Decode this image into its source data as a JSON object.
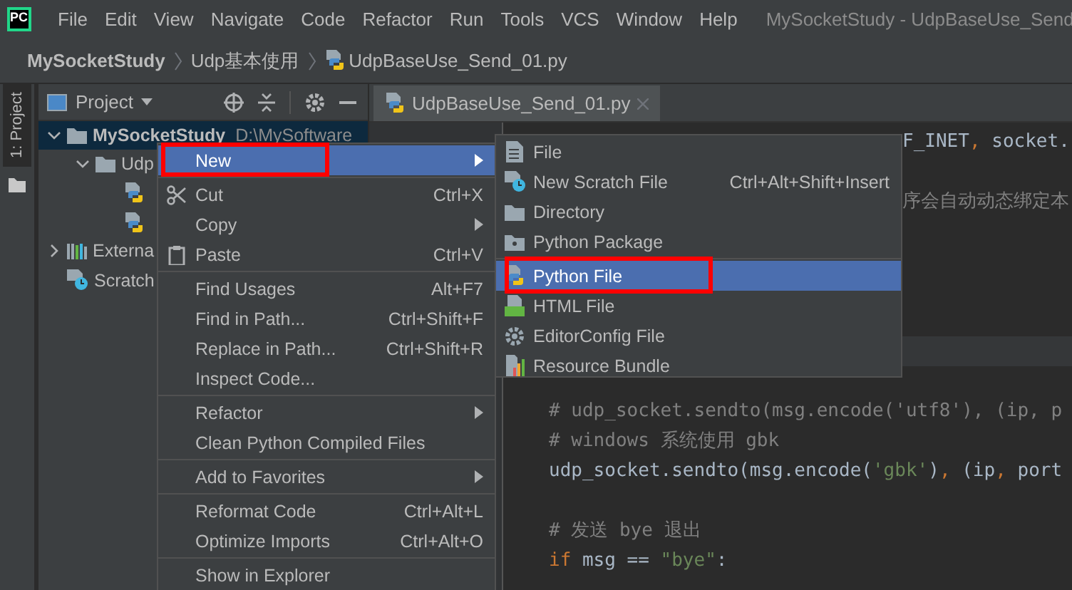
{
  "window": {
    "title": "MySocketStudy - UdpBaseUse_Send",
    "logo": "PC"
  },
  "menu_bar": [
    "File",
    "Edit",
    "View",
    "Navigate",
    "Code",
    "Refactor",
    "Run",
    "Tools",
    "VCS",
    "Window",
    "Help"
  ],
  "breadcrumbs": [
    {
      "label": "MySocketStudy",
      "kind": "project"
    },
    {
      "label": "Udp基本使用",
      "kind": "folder"
    },
    {
      "label": "UdpBaseUse_Send_01.py",
      "kind": "python"
    }
  ],
  "tool_strip": {
    "label": "1: Project"
  },
  "project_panel": {
    "title": "Project",
    "tree": [
      {
        "label": "MySocketStudy",
        "detail": "D:\\MySoftware",
        "kind": "folder",
        "expanded": true,
        "selected": true,
        "children": [
          {
            "label": "Udp",
            "kind": "folder",
            "expanded": true,
            "selected": false,
            "children": [
              {
                "kind": "python",
                "selected": false
              },
              {
                "kind": "python",
                "selected": false
              }
            ]
          }
        ]
      },
      {
        "label": "Externa",
        "kind": "library",
        "expanded": false,
        "selected": false
      },
      {
        "label": "Scratch",
        "kind": "scratch",
        "selected": false
      }
    ]
  },
  "editor": {
    "tab": {
      "label": "UdpBaseUse_Send_01.py",
      "selected": true
    },
    "lines": [
      {
        "kind": "partial",
        "current": false,
        "tokens": [
          {
            "text": "F_INET",
            "kind": "plain"
          },
          {
            "text": ",",
            "kind": "punct"
          },
          {
            "text": " socket.",
            "kind": "plain"
          }
        ]
      },
      {
        "kind": "normal",
        "current": false
      },
      {
        "kind": "partial",
        "current": false,
        "tokens": [
          {
            "text": "序会自动动态绑定本",
            "kind": "comment"
          }
        ]
      },
      {
        "kind": "normal",
        "current": false
      },
      {
        "kind": "normal",
        "current": false
      },
      {
        "kind": "normal",
        "current": false
      },
      {
        "kind": "normal",
        "current": false
      },
      {
        "kind": "normal",
        "current": true
      },
      {
        "kind": "normal",
        "current": false
      },
      {
        "kind": "normal",
        "current": false,
        "tokens": [
          {
            "text": "# udp_socket.sendto(msg.encode('utf8'), (ip, p",
            "kind": "comment"
          }
        ]
      },
      {
        "kind": "normal",
        "current": false,
        "tokens": [
          {
            "text": "# windows 系统使用 gbk",
            "kind": "comment"
          }
        ]
      },
      {
        "kind": "normal",
        "current": false,
        "tokens": [
          {
            "text": "udp_socket.sendto(msg.encode(",
            "kind": "plain"
          },
          {
            "text": "'gbk'",
            "kind": "string"
          },
          {
            "text": ")",
            "kind": "plain"
          },
          {
            "text": ",",
            "kind": "punct"
          },
          {
            "text": " (ip",
            "kind": "plain"
          },
          {
            "text": ",",
            "kind": "punct"
          },
          {
            "text": " port",
            "kind": "plain"
          }
        ]
      },
      {
        "kind": "normal",
        "current": false
      },
      {
        "kind": "normal",
        "current": false,
        "tokens": [
          {
            "text": "# 发送 bye 退出",
            "kind": "comment"
          }
        ]
      },
      {
        "kind": "normal",
        "current": false,
        "tokens": [
          {
            "text": "if",
            "kind": "keyword"
          },
          {
            "text": " msg == ",
            "kind": "plain"
          },
          {
            "text": "\"bye\"",
            "kind": "string"
          },
          {
            "text": ":",
            "kind": "plain"
          }
        ]
      }
    ]
  },
  "context_menu": {
    "items": [
      {
        "kind": "item",
        "label": "New",
        "submenu": true,
        "selected": true,
        "annotated": true
      },
      {
        "kind": "separator"
      },
      {
        "kind": "item",
        "label": "Cut",
        "shortcut": "Ctrl+X",
        "selected": false,
        "annotated": false
      },
      {
        "kind": "item",
        "label": "Copy",
        "submenu": true,
        "selected": false,
        "annotated": false
      },
      {
        "kind": "item",
        "label": "Paste",
        "shortcut": "Ctrl+V",
        "selected": false,
        "annotated": false
      },
      {
        "kind": "separator"
      },
      {
        "kind": "item",
        "label": "Find Usages",
        "shortcut": "Alt+F7",
        "selected": false,
        "annotated": false
      },
      {
        "kind": "item",
        "label": "Find in Path...",
        "shortcut": "Ctrl+Shift+F",
        "selected": false,
        "annotated": false
      },
      {
        "kind": "item",
        "label": "Replace in Path...",
        "shortcut": "Ctrl+Shift+R",
        "selected": false,
        "annotated": false
      },
      {
        "kind": "item",
        "label": "Inspect Code...",
        "selected": false,
        "annotated": false
      },
      {
        "kind": "separator"
      },
      {
        "kind": "item",
        "label": "Refactor",
        "submenu": true,
        "selected": false,
        "annotated": false
      },
      {
        "kind": "item",
        "label": "Clean Python Compiled Files",
        "selected": false,
        "annotated": false
      },
      {
        "kind": "separator"
      },
      {
        "kind": "item",
        "label": "Add to Favorites",
        "submenu": true,
        "selected": false,
        "annotated": false
      },
      {
        "kind": "separator"
      },
      {
        "kind": "item",
        "label": "Reformat Code",
        "shortcut": "Ctrl+Alt+L",
        "selected": false,
        "annotated": false
      },
      {
        "kind": "item",
        "label": "Optimize Imports",
        "shortcut": "Ctrl+Alt+O",
        "selected": false,
        "annotated": false
      },
      {
        "kind": "separator"
      },
      {
        "kind": "item",
        "label": "Show in Explorer",
        "selected": false,
        "annotated": false
      }
    ]
  },
  "submenu": {
    "items": [
      {
        "kind": "item",
        "label": "File",
        "selected": false,
        "annotated": false
      },
      {
        "kind": "item",
        "label": "New Scratch File",
        "shortcut": "Ctrl+Alt+Shift+Insert",
        "selected": false,
        "annotated": false
      },
      {
        "kind": "item",
        "label": "Directory",
        "selected": false,
        "annotated": false
      },
      {
        "kind": "item",
        "label": "Python Package",
        "selected": false,
        "annotated": false
      },
      {
        "kind": "separator"
      },
      {
        "kind": "item",
        "label": "Python File",
        "selected": true,
        "annotated": true
      },
      {
        "kind": "item",
        "label": "HTML File",
        "selected": false,
        "annotated": false
      },
      {
        "kind": "item",
        "label": "EditorConfig File",
        "selected": false,
        "annotated": false
      },
      {
        "kind": "item",
        "label": "Resource Bundle",
        "selected": false,
        "annotated": false
      }
    ]
  }
}
